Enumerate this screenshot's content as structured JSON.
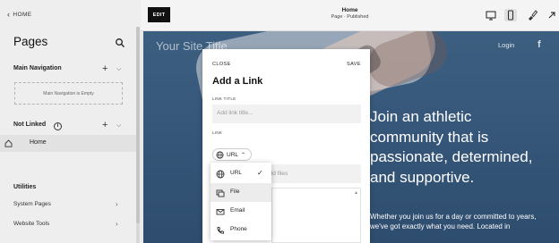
{
  "sidebar": {
    "back_label": "HOME",
    "title": "Pages",
    "main_nav_label": "Main Navigation",
    "main_nav_empty": "Main Navigation is Empty",
    "not_linked_label": "Not Linked",
    "info_glyph": "i",
    "pages": [
      {
        "label": "Home"
      }
    ],
    "utilities_label": "Utilities",
    "links": [
      {
        "label": "System Pages"
      },
      {
        "label": "Website Tools"
      }
    ]
  },
  "topbar": {
    "edit_label": "EDIT",
    "page_name": "Home",
    "page_status": "Page · Published"
  },
  "site": {
    "title": "Your Site Title",
    "login": "Login",
    "social_icon_glyph": "f",
    "hero_text": "Join an athletic community that is passionate, determined, and supportive.",
    "sub_text": "Whether you join us for a day or committed to years, we've got exactly what you need. Located in"
  },
  "modal": {
    "close_label": "CLOSE",
    "save_label": "SAVE",
    "title": "Add a Link",
    "link_title_label": "LINK TITLE",
    "link_title_placeholder": "Add link title...",
    "link_label": "LINK",
    "type_selected": "URL",
    "files_placeholder": "add files",
    "dropdown": [
      {
        "label": "URL",
        "icon": "globe-icon",
        "selected": true
      },
      {
        "label": "File",
        "icon": "file-icon",
        "highlighted": true
      },
      {
        "label": "Email",
        "icon": "email-icon"
      },
      {
        "label": "Phone",
        "icon": "phone-icon"
      }
    ]
  },
  "colors": {
    "hero_bg": "#36577a",
    "edit_bg": "#111111",
    "sidebar_bg": "#eeeeee"
  }
}
